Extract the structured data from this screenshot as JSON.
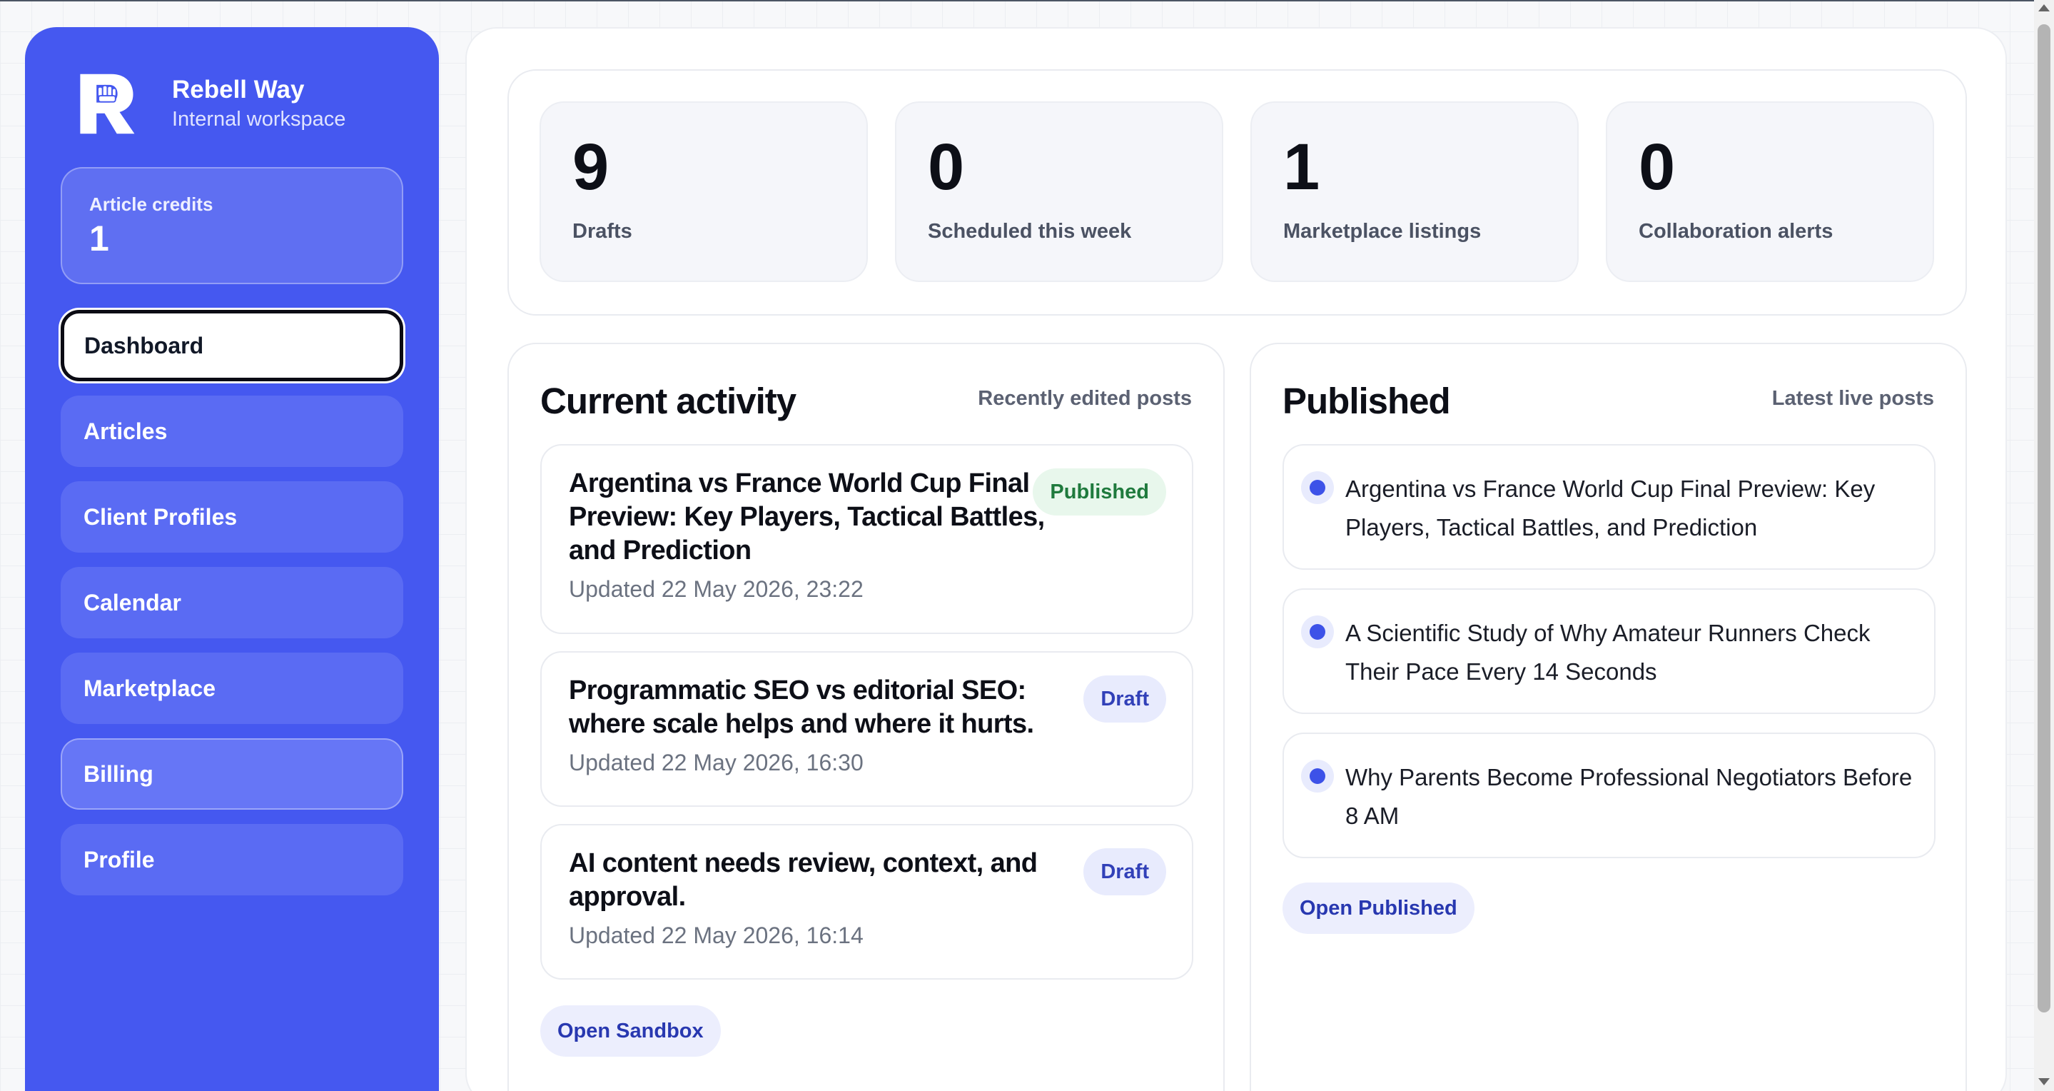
{
  "brand": {
    "name": "Rebell Way",
    "subtitle": "Internal workspace",
    "logo_icon": "rebell-way-fist-logo"
  },
  "credits": {
    "label": "Article credits",
    "value": "1"
  },
  "nav": {
    "items": [
      {
        "label": "Dashboard",
        "active": true
      },
      {
        "label": "Articles"
      },
      {
        "label": "Client Profiles"
      },
      {
        "label": "Calendar"
      },
      {
        "label": "Marketplace"
      },
      {
        "label": "Billing"
      },
      {
        "label": "Profile"
      }
    ]
  },
  "stats": [
    {
      "value": "9",
      "label": "Drafts"
    },
    {
      "value": "0",
      "label": "Scheduled this week"
    },
    {
      "value": "1",
      "label": "Marketplace listings"
    },
    {
      "value": "0",
      "label": "Collaboration alerts"
    }
  ],
  "activity": {
    "title": "Current activity",
    "subtitle": "Recently edited posts",
    "posts": [
      {
        "title": "Argentina vs France World Cup Final Preview: Key Players, Tactical Battles, and Prediction",
        "updated": "Updated 22 May 2026, 23:22",
        "status": "Published"
      },
      {
        "title": "Programmatic SEO vs editorial SEO: where scale helps and where it hurts.",
        "updated": "Updated 22 May 2026, 16:30",
        "status": "Draft"
      },
      {
        "title": "AI content needs review, context, and approval.",
        "updated": "Updated 22 May 2026, 16:14",
        "status": "Draft"
      }
    ],
    "button": "Open Sandbox"
  },
  "published": {
    "title": "Published",
    "subtitle": "Latest live posts",
    "posts": [
      "Argentina vs France World Cup Final Preview: Key Players, Tactical Battles, and Prediction",
      "A Scientific Study of Why Amateur Runners Check Their Pace Every 14 Seconds",
      "Why Parents Become Professional Negotiators Before 8 AM"
    ],
    "button": "Open Published"
  },
  "colors": {
    "sidebar": "#4558f0",
    "accent": "#3d52e8",
    "published_badge": "#1f7a3d",
    "draft_badge": "#3140b8"
  }
}
